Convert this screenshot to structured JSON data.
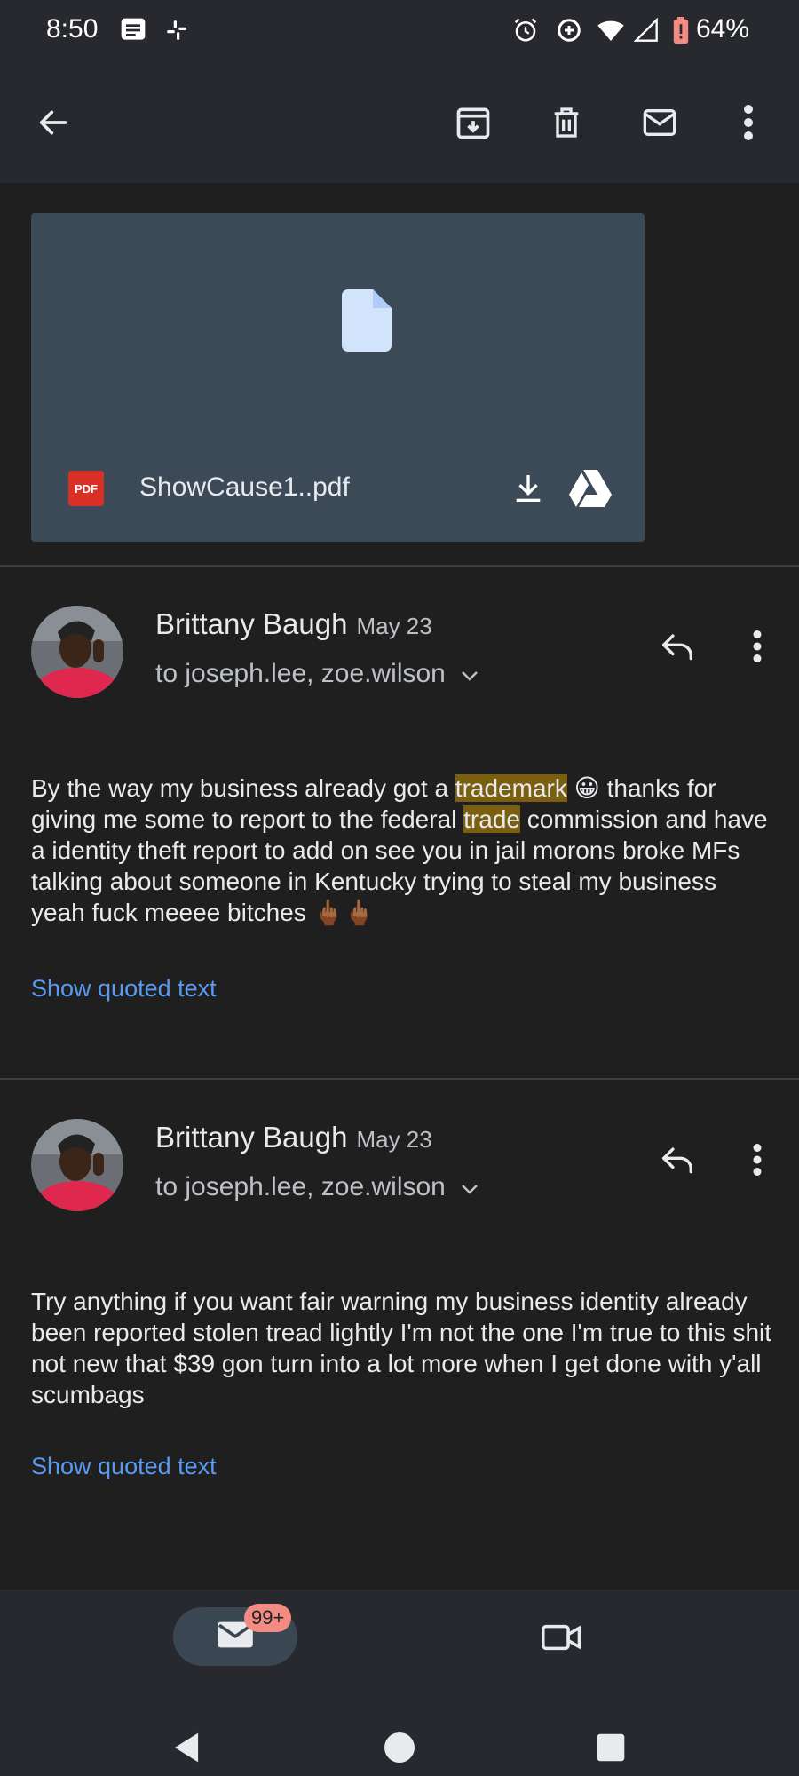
{
  "status_bar": {
    "time": "8:50",
    "battery": "64%",
    "icons": [
      "message-icon",
      "slack-icon",
      "alarm-icon",
      "data-saver-icon",
      "wifi-icon",
      "signal-icon",
      "battery-icon"
    ]
  },
  "toolbar": {
    "icons": [
      "back-arrow-icon",
      "archive-icon",
      "delete-icon",
      "mark-unread-icon",
      "more-vert-icon"
    ]
  },
  "attachment": {
    "type_badge": "PDF",
    "filename": "ShowCause1..pdf",
    "icons": [
      "file-icon",
      "download-icon",
      "google-drive-icon"
    ]
  },
  "messages": [
    {
      "sender": "Brittany Baugh",
      "date": "May 23",
      "recipients": "to joseph.lee, zoe.wilson",
      "body_parts": [
        "By the way my business already got a ",
        "trademark",
        " 😀 thanks for giving me some to report to the federal ",
        "trade",
        " commission and have a identity theft report to add on see you in jail morons broke MFs talking about someone in Kentucky trying to steal my business yeah fuck meeee bitches 🖕🏾🖕🏾"
      ],
      "show_quoted": "Show quoted text"
    },
    {
      "sender": "Brittany Baugh",
      "date": "May 23",
      "recipients": "to joseph.lee, zoe.wilson",
      "body": "Try anything if you want fair warning my business identity already been reported stolen tread lightly I'm not the one I'm true to this shit not new that $39 gon turn into a lot more when I get done with y'all scumbags",
      "show_quoted": "Show quoted text"
    }
  ],
  "bottom_nav": {
    "mail_badge": "99+",
    "items": [
      "mail-icon",
      "video-icon"
    ]
  },
  "colors": {
    "background": "#1f1f1f",
    "bars": "#27292f",
    "attachment": "#3c4a57",
    "link": "#5a9bf0",
    "highlight": "#7a5f10",
    "badge": "#f28b82"
  }
}
